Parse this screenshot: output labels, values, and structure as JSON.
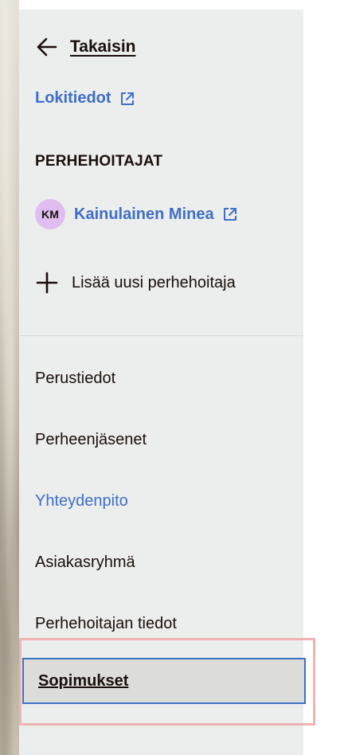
{
  "navigation": {
    "back_label": "Takaisin",
    "log_link_label": "Lokitiedot"
  },
  "family_caregivers": {
    "heading": "PERHEHOITAJAT",
    "people": [
      {
        "initials": "KM",
        "name": "Kainulainen Minea"
      }
    ],
    "add_label": "Lisää uusi perhehoitaja"
  },
  "menu": {
    "items": [
      {
        "label": "Perustiedot",
        "state": "default"
      },
      {
        "label": "Perheenjäsenet",
        "state": "default"
      },
      {
        "label": "Yhteydenpito",
        "state": "link"
      },
      {
        "label": "Asiakasryhmä",
        "state": "default"
      },
      {
        "label": "Perhehoitajan tiedot",
        "state": "default"
      },
      {
        "label": "Sopimukset",
        "state": "selected"
      }
    ]
  },
  "colors": {
    "link": "#3f6ec6",
    "text": "#1a0f0c",
    "sidebar_bg": "#eceeed",
    "avatar_bg": "#dfbdf0",
    "selected_border": "#3b72c4",
    "highlight_outline": "#f0b3b3"
  },
  "icons": {
    "back": "arrow-left-icon",
    "external": "external-link-icon",
    "add": "plus-icon"
  }
}
